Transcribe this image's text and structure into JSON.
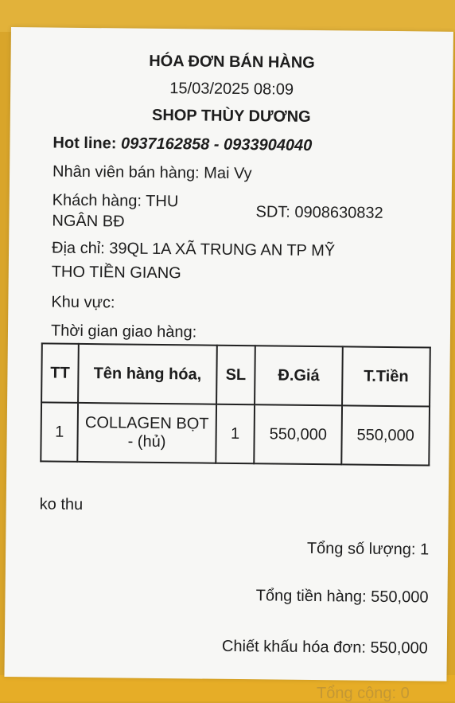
{
  "receipt": {
    "title": "HÓA ĐƠN BÁN HÀNG",
    "datetime": "15/03/2025 08:09",
    "shop_name": "SHOP THÙY DƯƠNG",
    "hotline_label": "Hot line:",
    "hotline_value": "0937162858 - 0933904040",
    "staff": "Nhân viên bán hàng: Mai Vy",
    "customer_line1": "Khách hàng: THU",
    "customer_line2": "NGÂN BĐ",
    "phone": "SDT: 0908630832",
    "address_line1": "Địa chỉ: 39QL 1A XÃ TRUNG AN TP MỸ",
    "address_line2": "THO TIỀN GIANG",
    "area": "Khu vực:",
    "delivery_time": "Thời gian giao hàng:",
    "table": {
      "headers": [
        "TT",
        "Tên hàng hóa,",
        "SL",
        "Đ.Giá",
        "T.Tiền"
      ],
      "rows": [
        [
          "1",
          "COLLAGEN BỌT - (hủ)",
          "1",
          "550,000",
          "550,000"
        ]
      ]
    },
    "note": "ko thu",
    "total_qty": "Tổng số lượng: 1",
    "total_goods": "Tổng tiền hàng: 550,000",
    "discount": "Chiết khấu hóa đơn: 550,000",
    "grand_total": "Tổng cộng: 0"
  }
}
